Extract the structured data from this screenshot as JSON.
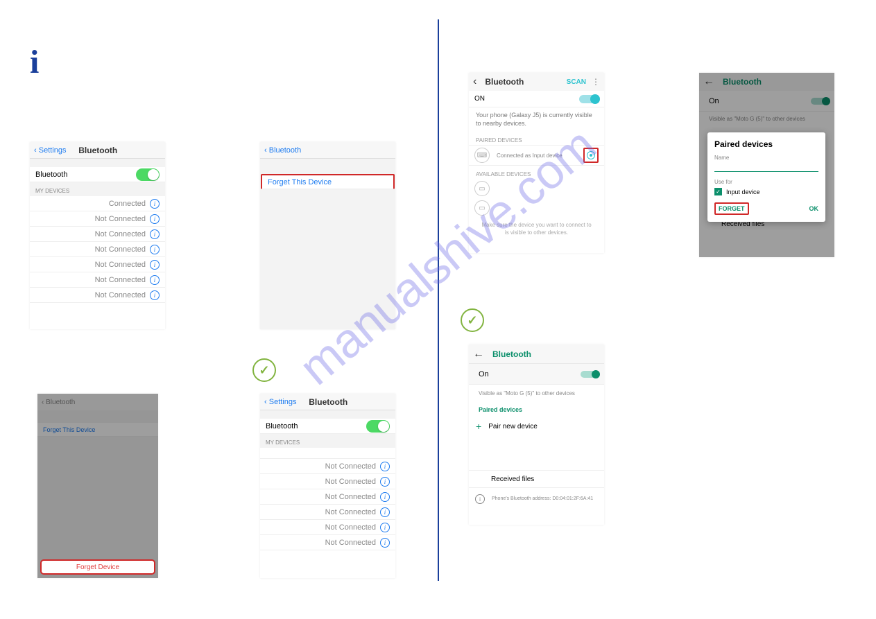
{
  "ios1": {
    "back": "Settings",
    "title": "Bluetooth",
    "bt_label": "Bluetooth",
    "section": "MY DEVICES",
    "connected": "Connected",
    "not_connected": "Not Connected"
  },
  "ios2": {
    "back": "Bluetooth",
    "forget": "Forget This Device"
  },
  "ios3": {
    "back": "Bluetooth",
    "forget": "Forget This Device",
    "forget_btn": "Forget Device"
  },
  "ios4": {
    "back": "Settings",
    "title": "Bluetooth",
    "bt_label": "Bluetooth",
    "section": "MY DEVICES",
    "not_connected": "Not Connected"
  },
  "and1": {
    "title": "Bluetooth",
    "scan": "SCAN",
    "on": "ON",
    "visible": "Your phone (Galaxy J5) is currently visible to nearby devices.",
    "paired": "PAIRED DEVICES",
    "connected_as": "Connected as Input device",
    "available": "AVAILABLE DEVICES",
    "hint": "Make sure the device you want to connect to is visible to other devices."
  },
  "and2": {
    "title": "Bluetooth",
    "on": "On",
    "visible": "Visible as \"Moto G (5)\" to other devices",
    "paired": "Paired devices",
    "pair_new": "Pair new device",
    "received": "Received files",
    "addr": "Phone's Bluetooth address: D0:04:01:2F:6A:41"
  },
  "and3": {
    "title": "Bluetooth",
    "on": "On",
    "visible": "Visible as \"Moto G (5)\" to other devices",
    "received": "Received files",
    "dlg_title": "Paired devices",
    "dlg_name": "Name",
    "dlg_use": "Use for",
    "dlg_input": "Input device",
    "dlg_forget": "FORGET",
    "dlg_ok": "OK"
  },
  "watermark": "manualshive.com"
}
